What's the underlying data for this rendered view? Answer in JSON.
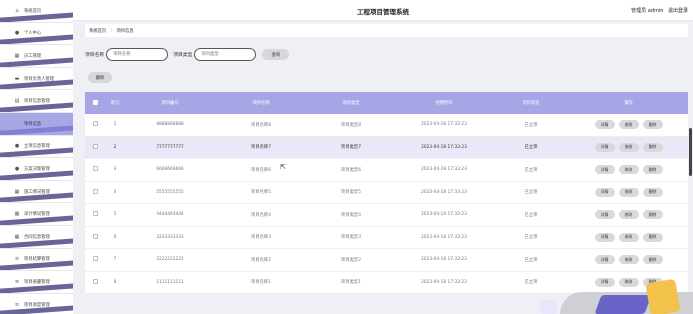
{
  "app_title": "工程项目管理系统",
  "header": {
    "user": "管理员 admin",
    "logout": "退出登录"
  },
  "sidebar": {
    "items": [
      {
        "label": "系统首页",
        "icon": "home-icon"
      },
      {
        "label": "个人中心",
        "icon": "user-icon"
      },
      {
        "label": "员工管理",
        "icon": "grid-icon"
      },
      {
        "label": "项目负责人管理",
        "icon": "monitor-icon"
      },
      {
        "label": "项目信息管理",
        "icon": "doc-icon"
      },
      {
        "label": "项目信息",
        "icon": "none",
        "active": true
      },
      {
        "label": "立项信息管理",
        "icon": "user-icon"
      },
      {
        "label": "方案决策管理",
        "icon": "user-icon"
      },
      {
        "label": "施工情况管理",
        "icon": "grid-icon"
      },
      {
        "label": "采计情况管理",
        "icon": "grid-icon"
      },
      {
        "label": "合同信息管理",
        "icon": "grid-icon"
      },
      {
        "label": "项目结算管理",
        "icon": "list-icon"
      },
      {
        "label": "项目质量管理",
        "icon": "list-icon"
      },
      {
        "label": "项目进度管理",
        "icon": "list-icon"
      }
    ]
  },
  "breadcrumb": {
    "home": "系统首页",
    "sep": "⋮",
    "current": "项目信息"
  },
  "search": {
    "name_label": "项目名称",
    "name_placeholder": "项目名称",
    "type_label": "项目类型",
    "type_placeholder": "项目类型",
    "query_button": "查询"
  },
  "delete_button": "删除",
  "table": {
    "headers": [
      "索引",
      "项目编号",
      "项目名称",
      "项目类型",
      "创建时间",
      "项目状态",
      "操作"
    ],
    "ops": {
      "detail": "详情",
      "edit": "修改",
      "delete": "删除"
    },
    "rows": [
      {
        "index": "1",
        "code": "8888888888",
        "name": "项目名称8",
        "type": "项目类型8",
        "time": "2023-04-18 17:33:23",
        "status": "已立项"
      },
      {
        "index": "2",
        "code": "7777777777",
        "name": "项目名称7",
        "type": "项目类型7",
        "time": "2023-04-18 17:33:23",
        "status": "已立项"
      },
      {
        "index": "3",
        "code": "6666666666",
        "name": "项目名称6",
        "type": "项目类型6",
        "time": "2023-04-18 17:33:23",
        "status": "已立项"
      },
      {
        "index": "4",
        "code": "5555555555",
        "name": "项目名称5",
        "type": "项目类型5",
        "time": "2023-04-18 17:33:23",
        "status": "已立项"
      },
      {
        "index": "5",
        "code": "4444444444",
        "name": "项目名称4",
        "type": "项目类型4",
        "time": "2023-04-18 17:33:23",
        "status": "已立项"
      },
      {
        "index": "6",
        "code": "3333333333",
        "name": "项目名称3",
        "type": "项目类型3",
        "time": "2023-04-18 17:33:23",
        "status": "已立项"
      },
      {
        "index": "7",
        "code": "2222222222",
        "name": "项目名称2",
        "type": "项目类型2",
        "time": "2023-04-18 17:33:23",
        "status": "已立项"
      },
      {
        "index": "8",
        "code": "1111111111",
        "name": "项目名称1",
        "type": "项目类型1",
        "time": "2023-04-18 17:33:23",
        "status": "已立项"
      }
    ]
  },
  "colors": {
    "accent": "#a7a5e5",
    "sidebar_stripe": "#4d4a86",
    "active_item": "#a9a6e6",
    "button": "#d7d7db"
  }
}
